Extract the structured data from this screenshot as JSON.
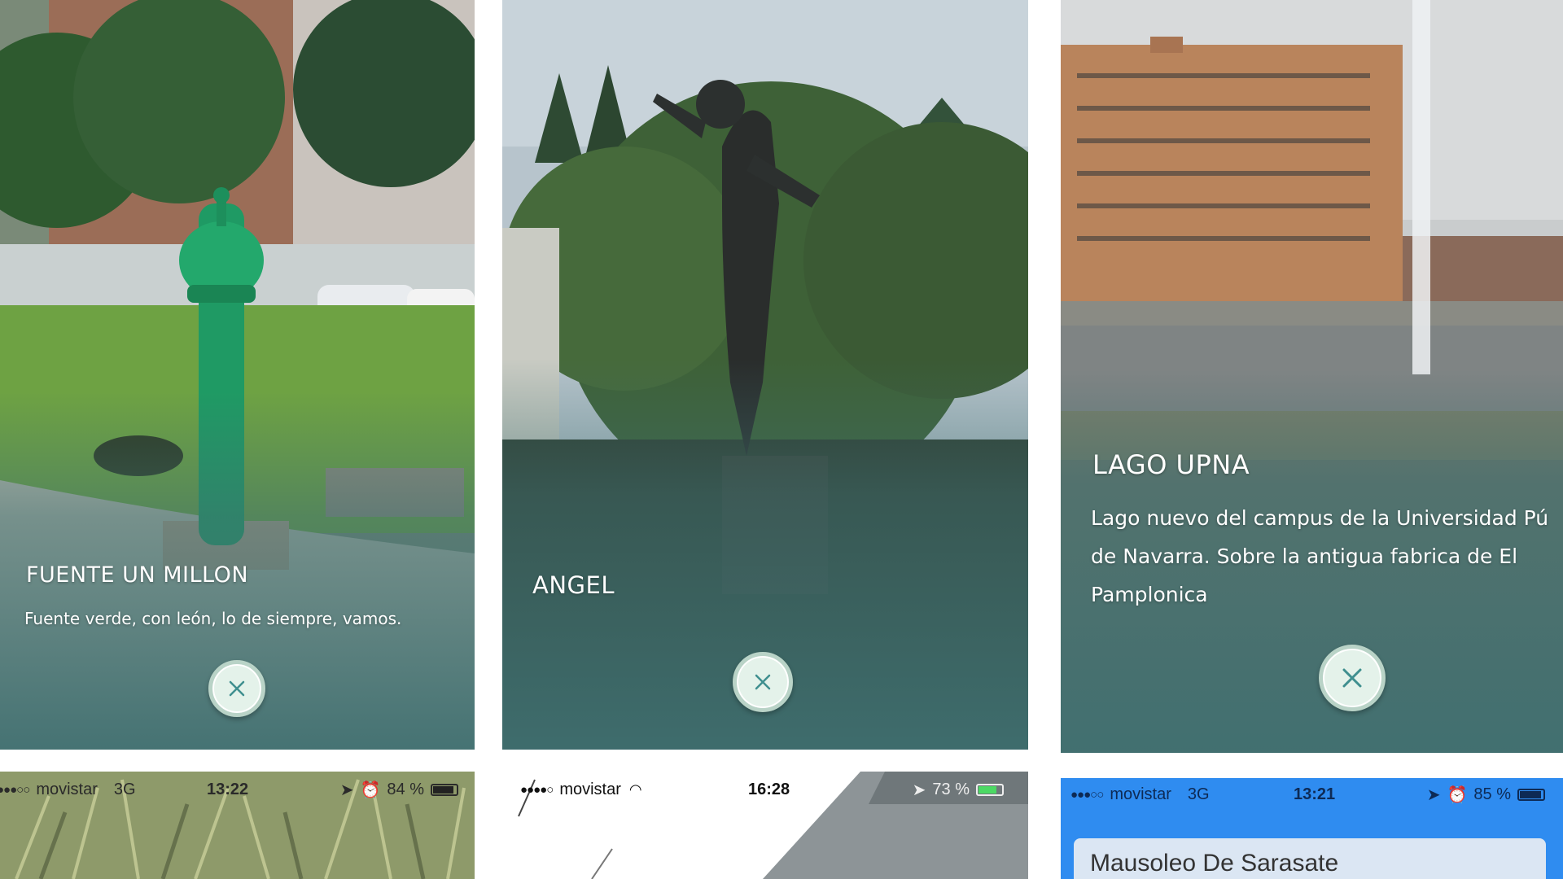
{
  "cards": [
    {
      "title": "FUENTE UN MILLON",
      "description": "Fuente verde, con león, lo de siempre, vamos.",
      "close_icon": "close-icon"
    },
    {
      "title": "ANGEL",
      "description": "",
      "close_icon": "close-icon"
    },
    {
      "title": "LAGO UPNA",
      "description_lines": [
        "Lago nuevo del campus de la Universidad Pú",
        "de Navarra. Sobre la antigua fabrica de El",
        "Pamplonica"
      ],
      "close_icon": "close-icon"
    }
  ],
  "status_bars": [
    {
      "signal": "●●●○○",
      "carrier": "movistar",
      "network": "3G",
      "time": "13:22",
      "battery": "84 %",
      "battery_level": 0.84
    },
    {
      "signal": "●●●●○",
      "carrier": "movistar",
      "network": "wifi",
      "time": "16:28",
      "battery": "73 %",
      "battery_level": 0.73
    },
    {
      "signal": "●●●○○",
      "carrier": "movistar",
      "network": "3G",
      "time": "13:21",
      "battery": "85 %",
      "battery_level": 0.85
    }
  ],
  "search_box": {
    "value": "Mausoleo De Sarasate"
  },
  "colors": {
    "overlay_teal": "#3f6f70",
    "close_button_fill": "#e4f2ea",
    "close_icon": "#3f8f8f",
    "search_blue": "#2f8cf0",
    "fountain_green": "#1f9a64"
  }
}
